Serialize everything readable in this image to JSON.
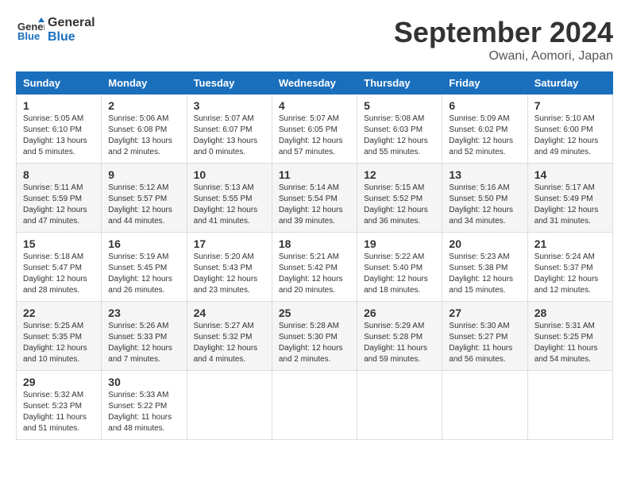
{
  "header": {
    "logo_line1": "General",
    "logo_line2": "Blue",
    "month": "September 2024",
    "location": "Owani, Aomori, Japan"
  },
  "weekdays": [
    "Sunday",
    "Monday",
    "Tuesday",
    "Wednesday",
    "Thursday",
    "Friday",
    "Saturday"
  ],
  "weeks": [
    [
      {
        "day": "1",
        "sunrise": "5:05 AM",
        "sunset": "6:10 PM",
        "daylight": "13 hours and 5 minutes."
      },
      {
        "day": "2",
        "sunrise": "5:06 AM",
        "sunset": "6:08 PM",
        "daylight": "13 hours and 2 minutes."
      },
      {
        "day": "3",
        "sunrise": "5:07 AM",
        "sunset": "6:07 PM",
        "daylight": "13 hours and 0 minutes."
      },
      {
        "day": "4",
        "sunrise": "5:07 AM",
        "sunset": "6:05 PM",
        "daylight": "12 hours and 57 minutes."
      },
      {
        "day": "5",
        "sunrise": "5:08 AM",
        "sunset": "6:03 PM",
        "daylight": "12 hours and 55 minutes."
      },
      {
        "day": "6",
        "sunrise": "5:09 AM",
        "sunset": "6:02 PM",
        "daylight": "12 hours and 52 minutes."
      },
      {
        "day": "7",
        "sunrise": "5:10 AM",
        "sunset": "6:00 PM",
        "daylight": "12 hours and 49 minutes."
      }
    ],
    [
      {
        "day": "8",
        "sunrise": "5:11 AM",
        "sunset": "5:59 PM",
        "daylight": "12 hours and 47 minutes."
      },
      {
        "day": "9",
        "sunrise": "5:12 AM",
        "sunset": "5:57 PM",
        "daylight": "12 hours and 44 minutes."
      },
      {
        "day": "10",
        "sunrise": "5:13 AM",
        "sunset": "5:55 PM",
        "daylight": "12 hours and 41 minutes."
      },
      {
        "day": "11",
        "sunrise": "5:14 AM",
        "sunset": "5:54 PM",
        "daylight": "12 hours and 39 minutes."
      },
      {
        "day": "12",
        "sunrise": "5:15 AM",
        "sunset": "5:52 PM",
        "daylight": "12 hours and 36 minutes."
      },
      {
        "day": "13",
        "sunrise": "5:16 AM",
        "sunset": "5:50 PM",
        "daylight": "12 hours and 34 minutes."
      },
      {
        "day": "14",
        "sunrise": "5:17 AM",
        "sunset": "5:49 PM",
        "daylight": "12 hours and 31 minutes."
      }
    ],
    [
      {
        "day": "15",
        "sunrise": "5:18 AM",
        "sunset": "5:47 PM",
        "daylight": "12 hours and 28 minutes."
      },
      {
        "day": "16",
        "sunrise": "5:19 AM",
        "sunset": "5:45 PM",
        "daylight": "12 hours and 26 minutes."
      },
      {
        "day": "17",
        "sunrise": "5:20 AM",
        "sunset": "5:43 PM",
        "daylight": "12 hours and 23 minutes."
      },
      {
        "day": "18",
        "sunrise": "5:21 AM",
        "sunset": "5:42 PM",
        "daylight": "12 hours and 20 minutes."
      },
      {
        "day": "19",
        "sunrise": "5:22 AM",
        "sunset": "5:40 PM",
        "daylight": "12 hours and 18 minutes."
      },
      {
        "day": "20",
        "sunrise": "5:23 AM",
        "sunset": "5:38 PM",
        "daylight": "12 hours and 15 minutes."
      },
      {
        "day": "21",
        "sunrise": "5:24 AM",
        "sunset": "5:37 PM",
        "daylight": "12 hours and 12 minutes."
      }
    ],
    [
      {
        "day": "22",
        "sunrise": "5:25 AM",
        "sunset": "5:35 PM",
        "daylight": "12 hours and 10 minutes."
      },
      {
        "day": "23",
        "sunrise": "5:26 AM",
        "sunset": "5:33 PM",
        "daylight": "12 hours and 7 minutes."
      },
      {
        "day": "24",
        "sunrise": "5:27 AM",
        "sunset": "5:32 PM",
        "daylight": "12 hours and 4 minutes."
      },
      {
        "day": "25",
        "sunrise": "5:28 AM",
        "sunset": "5:30 PM",
        "daylight": "12 hours and 2 minutes."
      },
      {
        "day": "26",
        "sunrise": "5:29 AM",
        "sunset": "5:28 PM",
        "daylight": "11 hours and 59 minutes."
      },
      {
        "day": "27",
        "sunrise": "5:30 AM",
        "sunset": "5:27 PM",
        "daylight": "11 hours and 56 minutes."
      },
      {
        "day": "28",
        "sunrise": "5:31 AM",
        "sunset": "5:25 PM",
        "daylight": "11 hours and 54 minutes."
      }
    ],
    [
      {
        "day": "29",
        "sunrise": "5:32 AM",
        "sunset": "5:23 PM",
        "daylight": "11 hours and 51 minutes."
      },
      {
        "day": "30",
        "sunrise": "5:33 AM",
        "sunset": "5:22 PM",
        "daylight": "11 hours and 48 minutes."
      },
      null,
      null,
      null,
      null,
      null
    ]
  ]
}
